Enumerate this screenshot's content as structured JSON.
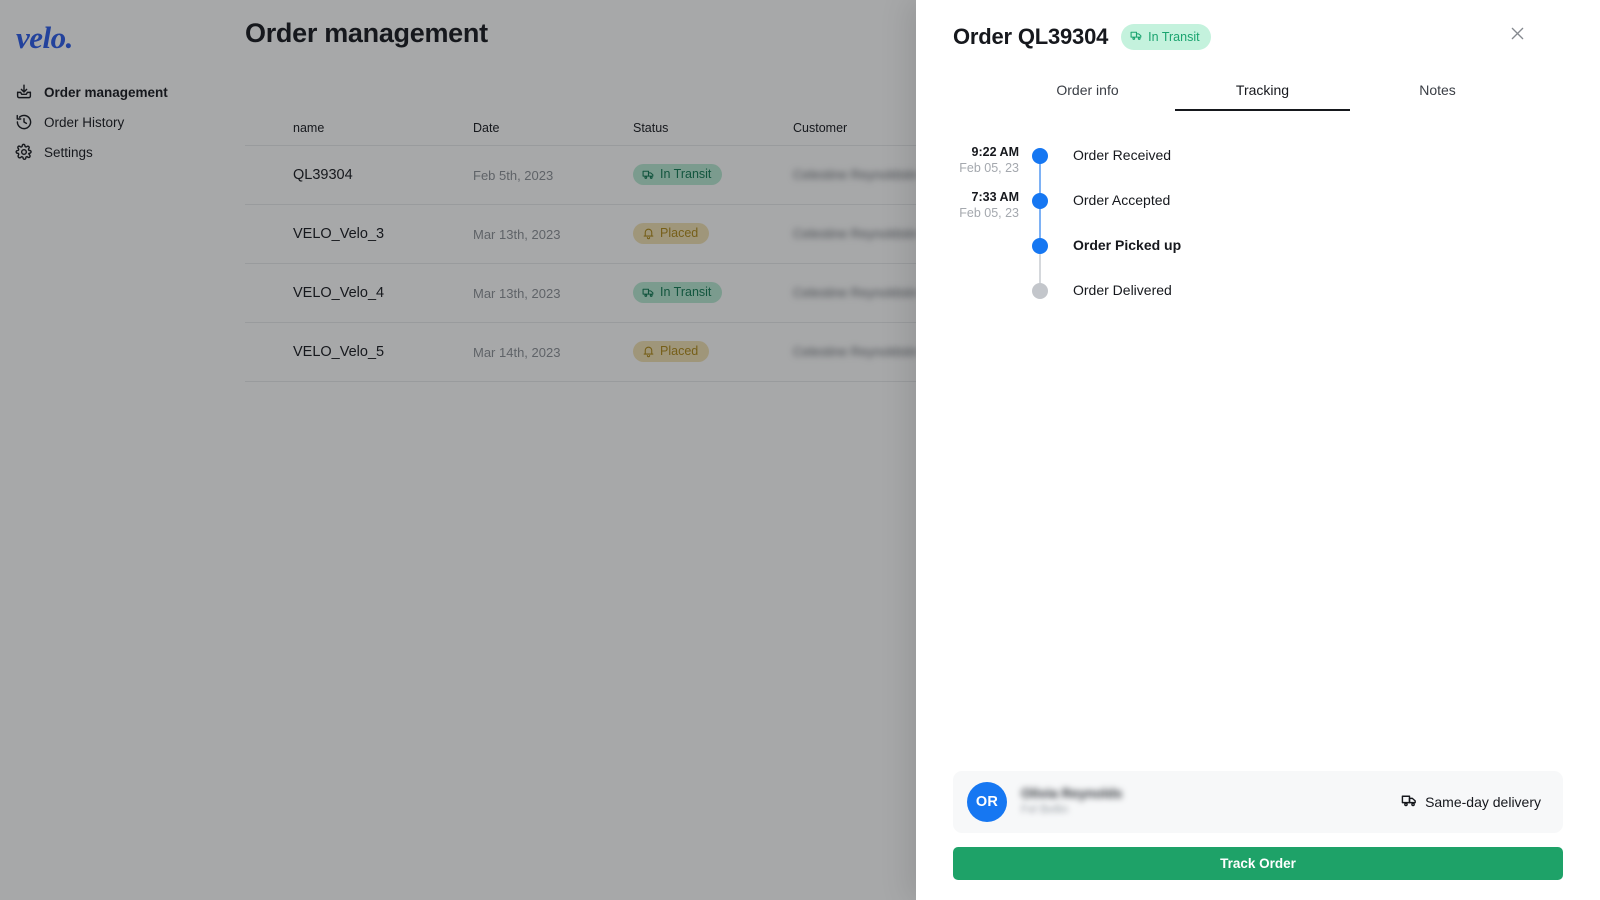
{
  "sidebar": {
    "logo": "velo.",
    "items": [
      {
        "label": "Order management",
        "icon": "inbox-download-icon",
        "active": true
      },
      {
        "label": "Order History",
        "icon": "history-clock-icon",
        "active": false
      },
      {
        "label": "Settings",
        "icon": "gear-icon",
        "active": false
      }
    ]
  },
  "main": {
    "title": "Order management",
    "table": {
      "columns": [
        "name",
        "Date",
        "Status",
        "Customer"
      ],
      "rows": [
        {
          "name": "QL39304",
          "date": "Feb 5th, 2023",
          "status": "In Transit",
          "status_kind": "transit",
          "customer": "Celestine Reynoldstin"
        },
        {
          "name": "VELO_Velo_3",
          "date": "Mar 13th, 2023",
          "status": "Placed",
          "status_kind": "placed",
          "customer": "Celestine Reynoldstin"
        },
        {
          "name": "VELO_Velo_4",
          "date": "Mar 13th, 2023",
          "status": "In Transit",
          "status_kind": "transit",
          "customer": "Celestine Reynoldstin"
        },
        {
          "name": "VELO_Velo_5",
          "date": "Mar 14th, 2023",
          "status": "Placed",
          "status_kind": "placed",
          "customer": "Celestine Reynoldstin"
        }
      ]
    }
  },
  "panel": {
    "title": "Order QL39304",
    "badge": "In Transit",
    "close_icon": "close-icon",
    "tabs": [
      {
        "label": "Order info",
        "active": false
      },
      {
        "label": "Tracking",
        "active": true
      },
      {
        "label": "Notes",
        "active": false
      }
    ],
    "timeline": [
      {
        "time": "9:22 AM",
        "date": "Feb 05, 23",
        "label": "Order Received",
        "state": "done"
      },
      {
        "time": "7:33 AM",
        "date": "Feb 05, 23",
        "label": "Order Accepted",
        "state": "done"
      },
      {
        "time": "",
        "date": "",
        "label": "Order Picked up",
        "state": "current"
      },
      {
        "time": "",
        "date": "",
        "label": "Order Delivered",
        "state": "pending"
      }
    ],
    "courier": {
      "initials": "OR",
      "name": "Olivia Reynolds",
      "subtitle": "Fel Bellin",
      "delivery_type": "Same-day delivery",
      "delivery_icon": "truck-icon"
    },
    "track_button": "Track Order"
  },
  "colors": {
    "brand_blue": "#2a5bea",
    "dot_blue": "#1677f2",
    "track_green": "#1ea268",
    "badge_transit_bg": "#c4f2dd",
    "badge_transit_fg": "#1aa46f",
    "badge_placed_bg": "#f3e3b4",
    "badge_placed_fg": "#b08a17"
  }
}
